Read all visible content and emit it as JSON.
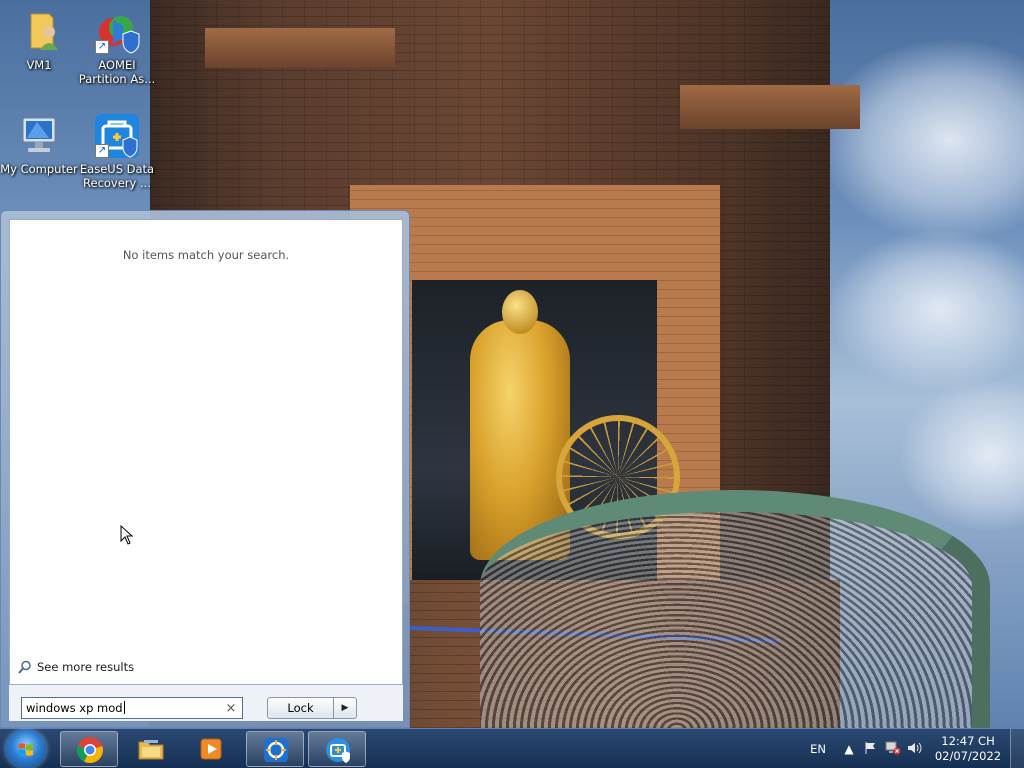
{
  "desktop": {
    "icons": [
      {
        "label": "VM1",
        "icon": "user-folder-icon"
      },
      {
        "label": "AOMEI Partition As...",
        "icon": "aomei-partition-icon"
      },
      {
        "label": "My Computer",
        "icon": "computer-icon"
      },
      {
        "label": "EaseUS Data Recovery ...",
        "icon": "easeus-recovery-icon"
      }
    ]
  },
  "start_menu": {
    "no_results_text": "No items match your search.",
    "see_more_label": "See more results",
    "search": {
      "value": "windows xp mod",
      "clear_glyph": "×"
    },
    "power": {
      "label": "Lock",
      "arrow": "▶"
    }
  },
  "taskbar": {
    "apps": [
      {
        "name": "chrome-icon",
        "active": true
      },
      {
        "name": "file-explorer-icon",
        "active": false
      },
      {
        "name": "media-player-icon",
        "active": false
      },
      {
        "name": "easeus-backup-icon",
        "active": true
      },
      {
        "name": "easeus-recovery-icon",
        "active": true
      }
    ],
    "tray": {
      "language": "EN",
      "time": "12:47 CH",
      "date": "02/07/2022"
    }
  },
  "colors": {
    "taskbar": "#1c3a63",
    "accent": "#2d7fd4"
  }
}
